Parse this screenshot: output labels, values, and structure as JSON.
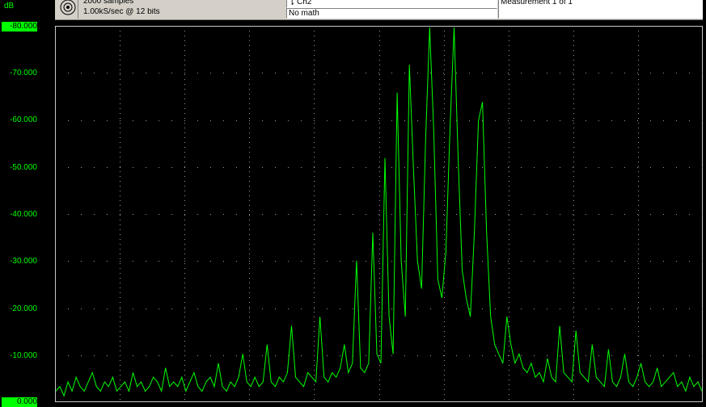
{
  "acquisition": {
    "samples": "2000 samples",
    "rate": "1.00kS/sec @ 12 bits"
  },
  "channel": {
    "label": "Ch2",
    "math": "No math"
  },
  "measurement": {
    "label": "Measurement 1 of 1"
  },
  "axis": {
    "unit": "dB",
    "tick_labels": [
      "-80.000",
      "-70.000",
      "-60.000",
      "-50.000",
      "-40.000",
      "-30.000",
      "-20.000",
      "-10.000",
      "0.000"
    ]
  },
  "colors": {
    "trace": "#00ff00",
    "grid_dots": "#9a9a9a",
    "plot_border": "#c8c8c8",
    "background": "#000000",
    "toolbar": "#d4d0c8"
  },
  "icons": {
    "scope": "concentric-circles-icon",
    "channel": "probe-icon"
  },
  "chart_data": {
    "type": "line",
    "ylabel": "dB",
    "y_tick_labels": [
      "-80.000",
      "-70.000",
      "-60.000",
      "-50.000",
      "-40.000",
      "-30.000",
      "-20.000",
      "-10.000",
      "0.000"
    ],
    "grid": true,
    "series": [
      {
        "values": [
          -2,
          -3,
          -1,
          -4,
          -2,
          -5,
          -3,
          -2,
          -4,
          -6,
          -3,
          -2,
          -4,
          -3,
          -5,
          -2,
          -3,
          -4,
          -2,
          -6,
          -3,
          -4,
          -2,
          -3,
          -5,
          -4,
          -2,
          -7,
          -3,
          -4,
          -3,
          -5,
          -2,
          -4,
          -6,
          -3,
          -2,
          -4,
          -5,
          -3,
          -8,
          -3,
          -2,
          -4,
          -3,
          -5,
          -10,
          -4,
          -3,
          -5,
          -3,
          -4,
          -12,
          -4,
          -3,
          -5,
          -4,
          -6,
          -16,
          -5,
          -4,
          -3,
          -6,
          -5,
          -4,
          -18,
          -5,
          -4,
          -6,
          -5,
          -7,
          -12,
          -6,
          -8,
          -30,
          -7,
          -6,
          -8,
          -36,
          -10,
          -8,
          -52,
          -18,
          -10,
          -66,
          -30,
          -18,
          -72,
          -50,
          -30,
          -24,
          -56,
          -80,
          -58,
          -26,
          -22,
          -32,
          -58,
          -80,
          -52,
          -28,
          -22,
          -18,
          -36,
          -60,
          -64,
          -36,
          -18,
          -12,
          -10,
          -8,
          -18,
          -12,
          -8,
          -10,
          -7,
          -6,
          -8,
          -5,
          -6,
          -4,
          -9,
          -5,
          -4,
          -16,
          -6,
          -5,
          -4,
          -15,
          -6,
          -5,
          -4,
          -12,
          -5,
          -4,
          -3,
          -11,
          -4,
          -3,
          -5,
          -10,
          -4,
          -3,
          -5,
          -8,
          -4,
          -3,
          -4,
          -7,
          -3,
          -4,
          -5,
          -6,
          -3,
          -4,
          -2,
          -5,
          -3,
          -4,
          -2
        ]
      }
    ]
  }
}
